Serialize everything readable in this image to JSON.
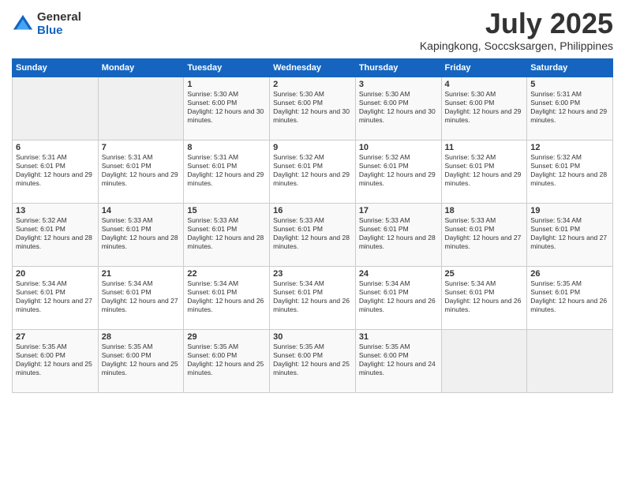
{
  "logo": {
    "general": "General",
    "blue": "Blue"
  },
  "title": "July 2025",
  "location": "Kapingkong, Soccsksargen, Philippines",
  "days_of_week": [
    "Sunday",
    "Monday",
    "Tuesday",
    "Wednesday",
    "Thursday",
    "Friday",
    "Saturday"
  ],
  "weeks": [
    [
      {
        "day": "",
        "info": ""
      },
      {
        "day": "",
        "info": ""
      },
      {
        "day": "1",
        "info": "Sunrise: 5:30 AM\nSunset: 6:00 PM\nDaylight: 12 hours and 30 minutes."
      },
      {
        "day": "2",
        "info": "Sunrise: 5:30 AM\nSunset: 6:00 PM\nDaylight: 12 hours and 30 minutes."
      },
      {
        "day": "3",
        "info": "Sunrise: 5:30 AM\nSunset: 6:00 PM\nDaylight: 12 hours and 30 minutes."
      },
      {
        "day": "4",
        "info": "Sunrise: 5:30 AM\nSunset: 6:00 PM\nDaylight: 12 hours and 29 minutes."
      },
      {
        "day": "5",
        "info": "Sunrise: 5:31 AM\nSunset: 6:00 PM\nDaylight: 12 hours and 29 minutes."
      }
    ],
    [
      {
        "day": "6",
        "info": "Sunrise: 5:31 AM\nSunset: 6:01 PM\nDaylight: 12 hours and 29 minutes."
      },
      {
        "day": "7",
        "info": "Sunrise: 5:31 AM\nSunset: 6:01 PM\nDaylight: 12 hours and 29 minutes."
      },
      {
        "day": "8",
        "info": "Sunrise: 5:31 AM\nSunset: 6:01 PM\nDaylight: 12 hours and 29 minutes."
      },
      {
        "day": "9",
        "info": "Sunrise: 5:32 AM\nSunset: 6:01 PM\nDaylight: 12 hours and 29 minutes."
      },
      {
        "day": "10",
        "info": "Sunrise: 5:32 AM\nSunset: 6:01 PM\nDaylight: 12 hours and 29 minutes."
      },
      {
        "day": "11",
        "info": "Sunrise: 5:32 AM\nSunset: 6:01 PM\nDaylight: 12 hours and 29 minutes."
      },
      {
        "day": "12",
        "info": "Sunrise: 5:32 AM\nSunset: 6:01 PM\nDaylight: 12 hours and 28 minutes."
      }
    ],
    [
      {
        "day": "13",
        "info": "Sunrise: 5:32 AM\nSunset: 6:01 PM\nDaylight: 12 hours and 28 minutes."
      },
      {
        "day": "14",
        "info": "Sunrise: 5:33 AM\nSunset: 6:01 PM\nDaylight: 12 hours and 28 minutes."
      },
      {
        "day": "15",
        "info": "Sunrise: 5:33 AM\nSunset: 6:01 PM\nDaylight: 12 hours and 28 minutes."
      },
      {
        "day": "16",
        "info": "Sunrise: 5:33 AM\nSunset: 6:01 PM\nDaylight: 12 hours and 28 minutes."
      },
      {
        "day": "17",
        "info": "Sunrise: 5:33 AM\nSunset: 6:01 PM\nDaylight: 12 hours and 28 minutes."
      },
      {
        "day": "18",
        "info": "Sunrise: 5:33 AM\nSunset: 6:01 PM\nDaylight: 12 hours and 27 minutes."
      },
      {
        "day": "19",
        "info": "Sunrise: 5:34 AM\nSunset: 6:01 PM\nDaylight: 12 hours and 27 minutes."
      }
    ],
    [
      {
        "day": "20",
        "info": "Sunrise: 5:34 AM\nSunset: 6:01 PM\nDaylight: 12 hours and 27 minutes."
      },
      {
        "day": "21",
        "info": "Sunrise: 5:34 AM\nSunset: 6:01 PM\nDaylight: 12 hours and 27 minutes."
      },
      {
        "day": "22",
        "info": "Sunrise: 5:34 AM\nSunset: 6:01 PM\nDaylight: 12 hours and 26 minutes."
      },
      {
        "day": "23",
        "info": "Sunrise: 5:34 AM\nSunset: 6:01 PM\nDaylight: 12 hours and 26 minutes."
      },
      {
        "day": "24",
        "info": "Sunrise: 5:34 AM\nSunset: 6:01 PM\nDaylight: 12 hours and 26 minutes."
      },
      {
        "day": "25",
        "info": "Sunrise: 5:34 AM\nSunset: 6:01 PM\nDaylight: 12 hours and 26 minutes."
      },
      {
        "day": "26",
        "info": "Sunrise: 5:35 AM\nSunset: 6:01 PM\nDaylight: 12 hours and 26 minutes."
      }
    ],
    [
      {
        "day": "27",
        "info": "Sunrise: 5:35 AM\nSunset: 6:00 PM\nDaylight: 12 hours and 25 minutes."
      },
      {
        "day": "28",
        "info": "Sunrise: 5:35 AM\nSunset: 6:00 PM\nDaylight: 12 hours and 25 minutes."
      },
      {
        "day": "29",
        "info": "Sunrise: 5:35 AM\nSunset: 6:00 PM\nDaylight: 12 hours and 25 minutes."
      },
      {
        "day": "30",
        "info": "Sunrise: 5:35 AM\nSunset: 6:00 PM\nDaylight: 12 hours and 25 minutes."
      },
      {
        "day": "31",
        "info": "Sunrise: 5:35 AM\nSunset: 6:00 PM\nDaylight: 12 hours and 24 minutes."
      },
      {
        "day": "",
        "info": ""
      },
      {
        "day": "",
        "info": ""
      }
    ]
  ]
}
